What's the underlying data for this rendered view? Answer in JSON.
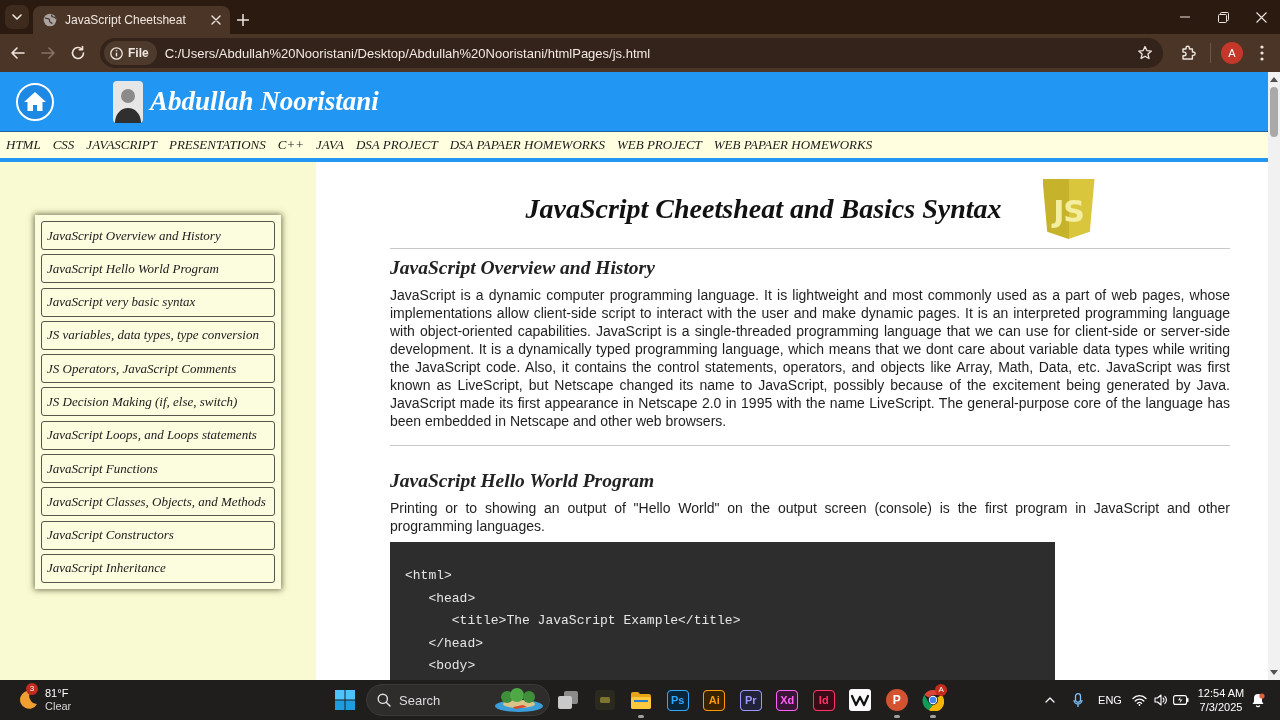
{
  "browser": {
    "tabs": [
      {
        "title": "JavaScript Cheetsheat",
        "selected": true
      }
    ],
    "nav_buttons": [
      {
        "kind": "back",
        "disabled": false
      },
      {
        "kind": "forward",
        "disabled": true
      },
      {
        "kind": "reload",
        "disabled": false
      }
    ],
    "address_bar": {
      "chip": "File",
      "url": "C:/Users/Abdullah%20Nooristani/Desktop/Abdullah%20Nooristani/htmlPages/js.html"
    },
    "profile": {
      "initial": "A"
    }
  },
  "header": {
    "name": "Abdullah Nooristani"
  },
  "nav": [
    "HTML",
    "CSS",
    "JAVASCRIPT",
    "PRESENTATIONS",
    "C++",
    "JAVA",
    "DSA PROJECT",
    "DSA PAPAER HOMEWORKS",
    "WEB PROJECT",
    "WEB PAPAER HOMEWORKS"
  ],
  "sidebar": {
    "items": [
      "JavaScript Overview and History",
      "JavaScript Hello World Program",
      "JavaScript very basic syntax",
      "JS variables, data types, type conversion",
      "JS Operators, JavaScript Comments",
      "JS Decision Making (if, else, switch)",
      "JavaScript Loops, and Loops statements",
      "JavaScript Functions",
      "JavaScript Classes, Objects, and Methods",
      "JavaScript Constructors",
      "JavaScript Inheritance"
    ]
  },
  "main": {
    "title": "JavaScript Cheetsheat and Basics Syntax",
    "logo_text": "JS",
    "sections": [
      {
        "heading": "JavaScript Overview and History",
        "paragraph": "JavaScript is a dynamic computer programming language. It is lightweight and most commonly used as a part of web pages, whose implementations allow client-side script to interact with the user and make dynamic pages. It is an interpreted programming language with object-oriented capabilities. JavaScript is a single-threaded programming language that we can use for client-side or server-side development. It is a dynamically typed programming language, which means that we dont care about variable data types while writing the JavaScript code. Also, it contains the control statements, operators, and objects like Array, Math, Data, etc. JavaScript was first known as LiveScript, but Netscape changed its name to JavaScript, possibly because of the excitement being generated by Java. JavaScript made its first appearance in Netscape 2.0 in 1995 with the name LiveScript. The general-purpose core of the language has been embedded in Netscape and other web browsers."
      },
      {
        "heading": "JavaScript Hello World Program",
        "paragraph": "Printing or to showing an output of \"Hello World\" on the output screen (console) is the first program in JavaScript and other programming languages.",
        "code": [
          "<html>",
          "   <head>",
          "      <title>The JavaScript Example</title>",
          "   </head>",
          "   <body>"
        ]
      }
    ]
  },
  "taskbar": {
    "weather": {
      "badge": "3",
      "temperature": "81°F",
      "condition": "Clear"
    },
    "search": {
      "label": "Search"
    },
    "apps": [
      {
        "kind": "stack",
        "running": false
      },
      {
        "kind": "tile",
        "running": false
      },
      {
        "kind": "folder",
        "running": true
      },
      {
        "kind": "letters",
        "label": "Ps",
        "color": "#31a8ff",
        "running": false
      },
      {
        "kind": "letters",
        "label": "Ai",
        "color": "#ff9a00",
        "running": false
      },
      {
        "kind": "letters",
        "label": "Pr",
        "color": "#9999ff",
        "running": false
      },
      {
        "kind": "letters",
        "label": "Xd",
        "color": "#ff61f6",
        "running": false
      },
      {
        "kind": "letters",
        "label": "Id",
        "color": "#ff3366",
        "running": false
      },
      {
        "kind": "zigzag",
        "running": false
      },
      {
        "kind": "disc",
        "label": "P",
        "color": "#d35230",
        "running": true
      },
      {
        "kind": "ring",
        "badge": "A",
        "running": true
      }
    ],
    "tray": {
      "language": "ENG",
      "time": "12:54 AM",
      "date": "7/3/2025"
    }
  }
}
